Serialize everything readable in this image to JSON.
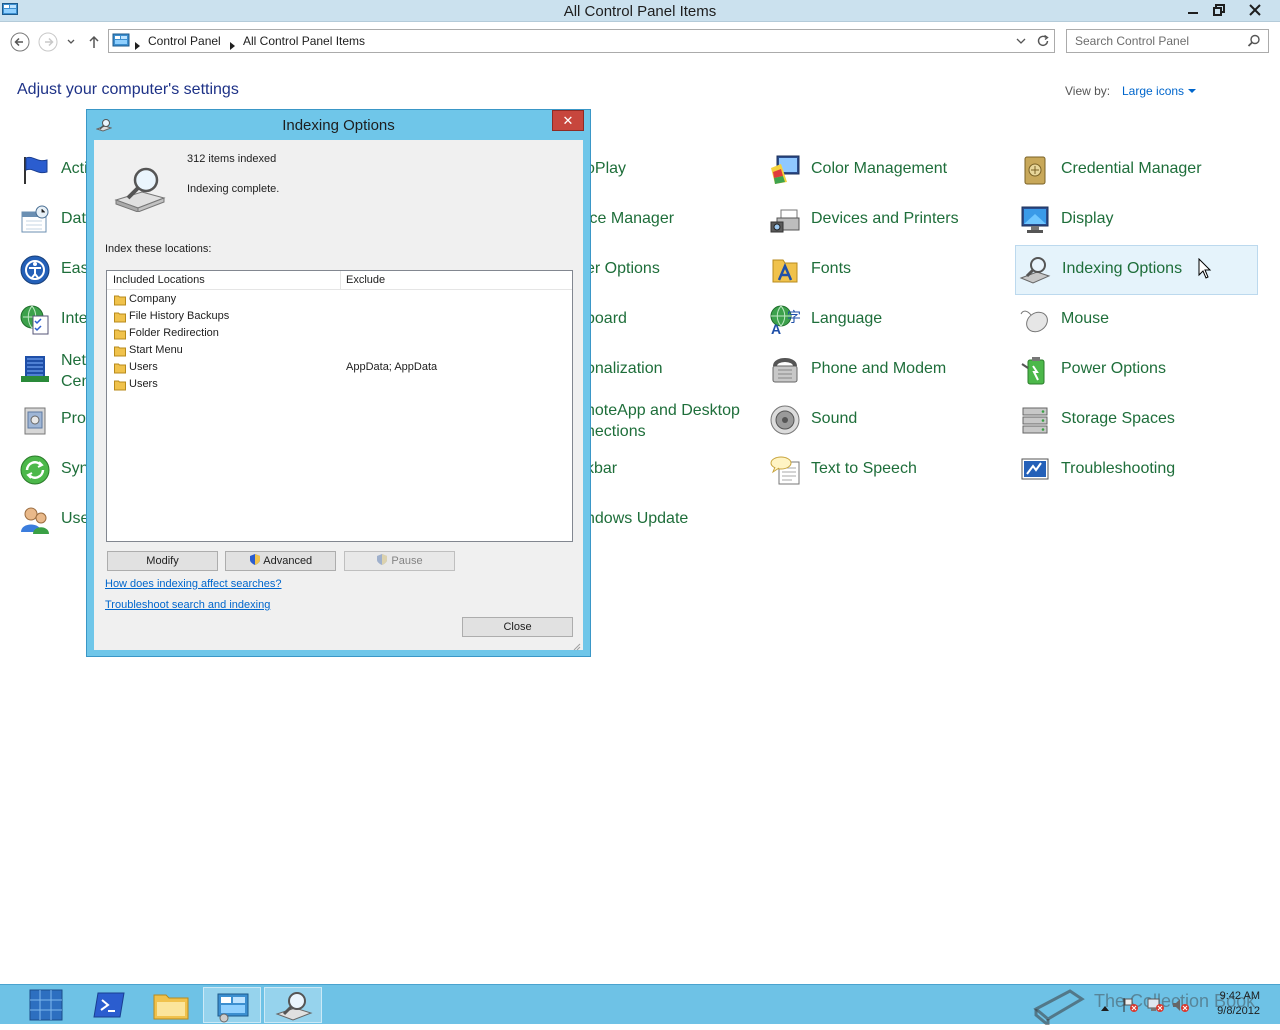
{
  "window": {
    "title": "All Control Panel Items"
  },
  "address": {
    "crumbs": [
      "Control Panel",
      "All Control Panel Items"
    ]
  },
  "search": {
    "placeholder": "Search Control Panel"
  },
  "main": {
    "heading": "Adjust your computer's settings",
    "view_by_label": "View by:",
    "view_by_value": "Large icons",
    "items": [
      {
        "label": "Acti"
      },
      {
        "label": "Dat"
      },
      {
        "label": "Eas"
      },
      {
        "label": "Inte"
      },
      {
        "label": "Net\nCen"
      },
      {
        "label": "Pro"
      },
      {
        "label": "Syn"
      },
      {
        "label": "Use"
      },
      {
        "label": "oPlay"
      },
      {
        "label": "ice Manager"
      },
      {
        "label": "er Options"
      },
      {
        "label": "board"
      },
      {
        "label": "onalization"
      },
      {
        "label": "noteApp and Desktop\nnections"
      },
      {
        "label": "kbar"
      },
      {
        "label": "ndows Update"
      },
      {
        "label": "Color Management"
      },
      {
        "label": "Devices and Printers"
      },
      {
        "label": "Fonts"
      },
      {
        "label": "Language"
      },
      {
        "label": "Phone and Modem"
      },
      {
        "label": "Sound"
      },
      {
        "label": "Text to Speech"
      },
      {
        "label": "Credential Manager"
      },
      {
        "label": "Display"
      },
      {
        "label": "Indexing Options"
      },
      {
        "label": "Mouse"
      },
      {
        "label": "Power Options"
      },
      {
        "label": "Storage Spaces"
      },
      {
        "label": "Troubleshooting"
      }
    ]
  },
  "dialog": {
    "title": "Indexing Options",
    "items_indexed": "312 items indexed",
    "status": "Indexing complete.",
    "index_label": "Index these locations:",
    "columns": [
      "Included Locations",
      "Exclude"
    ],
    "rows": [
      {
        "name": "Company",
        "exclude": ""
      },
      {
        "name": "File History Backups",
        "exclude": ""
      },
      {
        "name": "Folder Redirection",
        "exclude": ""
      },
      {
        "name": "Start Menu",
        "exclude": ""
      },
      {
        "name": "Users",
        "exclude": "AppData; AppData"
      },
      {
        "name": "Users",
        "exclude": ""
      }
    ],
    "buttons": {
      "modify": "Modify",
      "advanced": "Advanced",
      "pause": "Pause",
      "close": "Close"
    },
    "links": {
      "how": "How does indexing affect searches?",
      "troubleshoot": "Troubleshoot search and indexing"
    },
    "close_glyph": "✕"
  },
  "taskbar": {
    "time": "9:42 AM",
    "date": "9/8/2012",
    "watermark": "The Collection Book"
  }
}
